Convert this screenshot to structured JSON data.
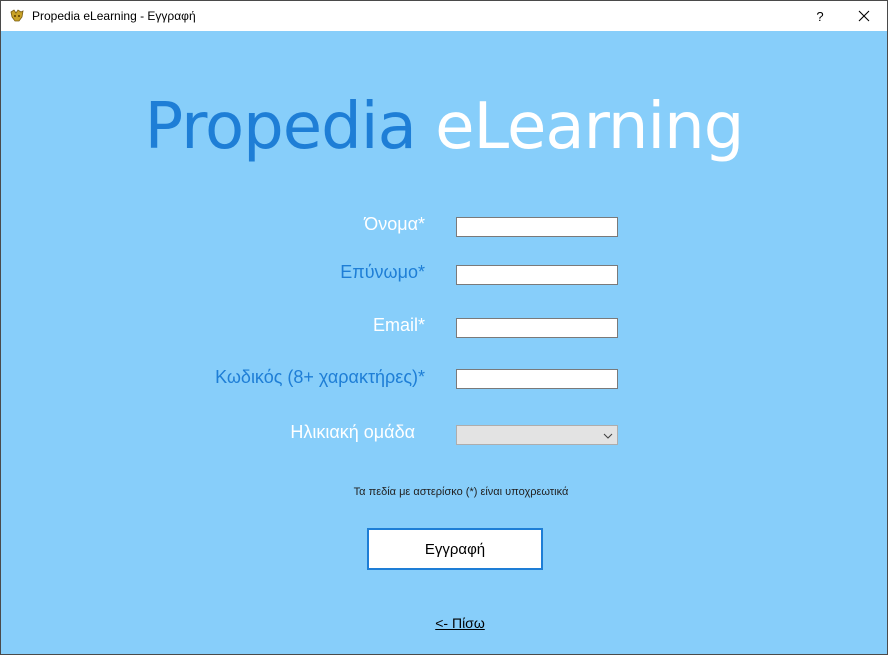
{
  "window": {
    "title": "Propedia eLearning - Εγγραφή",
    "help_label": "?",
    "close_label": "✕",
    "icon": "app-logo-icon"
  },
  "brand": {
    "part1": "Propedia",
    "part2": " eLearning"
  },
  "form": {
    "first_name_label": "Όνομα*",
    "first_name_value": "",
    "last_name_label": "Επύνωμο*",
    "last_name_value": "",
    "email_label": "Email*",
    "email_value": "",
    "password_label": "Κωδικός (8+ χαρακτήρες)*",
    "password_value": "",
    "age_group_label": "Ηλικιακή ομάδα",
    "age_group_selected": ""
  },
  "note": "Τα πεδία με αστερίσκο (*) είναι υποχρεωτικά",
  "register_button": "Εγγραφή",
  "back_link": "<- Πίσω",
  "colors": {
    "background": "#87cefa",
    "accent_blue": "#1e7ed6",
    "white": "#ffffff"
  }
}
